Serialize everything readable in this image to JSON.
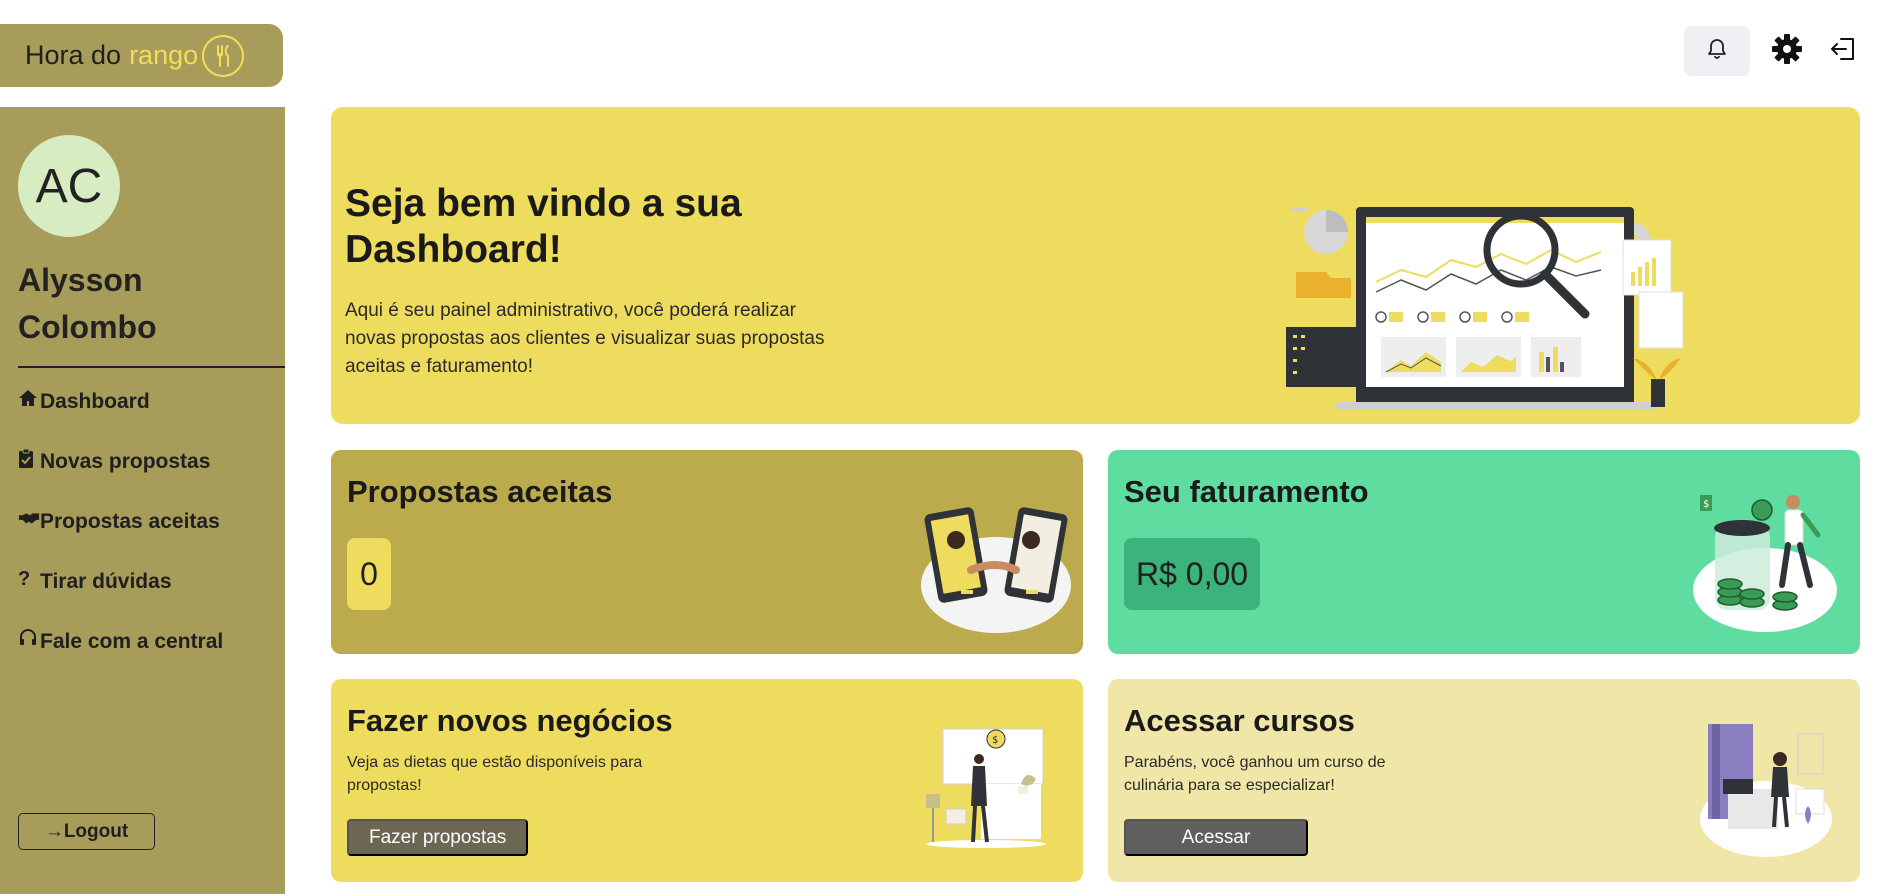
{
  "logo": {
    "text": "Hora do",
    "accent": "rango"
  },
  "topbar": {
    "icons": [
      "bell-icon",
      "gear-icon",
      "logout-icon"
    ]
  },
  "user": {
    "initials": "AC",
    "name": "Alysson Colombo"
  },
  "sidebar": {
    "items": [
      {
        "icon": "home-icon",
        "label": "Dashboard"
      },
      {
        "icon": "clipboard-icon",
        "label": "Novas propostas"
      },
      {
        "icon": "handshake-icon",
        "label": "Propostas aceitas"
      },
      {
        "icon": "question-icon",
        "label": "Tirar dúvidas"
      },
      {
        "icon": "headset-icon",
        "label": "Fale com a central"
      }
    ],
    "logout_label": "→Logout"
  },
  "hero": {
    "title": "Seja bem vindo a sua Dashboard!",
    "text": "Aqui é seu painel administrativo, você poderá realizar novas propostas aos clientes e visualizar suas propostas aceitas e faturamento!"
  },
  "cards": {
    "aceitas": {
      "title": "Propostas aceitas",
      "value": "0"
    },
    "faturamento": {
      "title": "Seu faturamento",
      "value": "R$ 0,00"
    },
    "negocios": {
      "title": "Fazer novos negócios",
      "text": "Veja as dietas que estão disponíveis para propostas!",
      "button": "Fazer propostas"
    },
    "cursos": {
      "title": "Acessar cursos",
      "text": "Parabéns, você ganhou um curso de culinária para se especializar!",
      "button": "Acessar"
    }
  },
  "colors": {
    "sidebar": "#a89c5b",
    "accent_yellow": "#eedc5e",
    "aceitas_card": "#bcab4c",
    "faturamento_card": "#5fdc9f",
    "cursos_card": "#f0e6a8"
  }
}
